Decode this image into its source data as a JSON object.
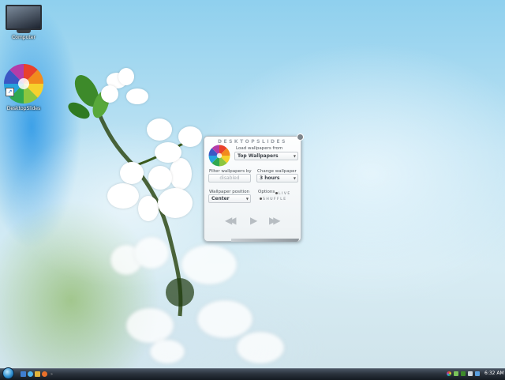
{
  "desktop": {
    "icons": [
      {
        "label": "Computer",
        "icon": "computer-icon"
      },
      {
        "label": "DesktopSlides",
        "icon": "desktopslides-icon"
      }
    ]
  },
  "gadget": {
    "title": "DESKTOPSLIDES",
    "load_label": "Load wallpapers from",
    "load_value": "Top Wallpapers",
    "filter_label": "Filter wallpapers by",
    "filter_value": "disabled",
    "change_label": "Change wallpaper in",
    "change_value": "3 hours",
    "position_label": "Wallpaper position",
    "position_value": "Center",
    "options_label": "Options",
    "options": [
      "LIVE",
      "SHUFFLE"
    ],
    "controls": {
      "prev": "◀◀",
      "play": "▶",
      "next": "▶▶"
    }
  },
  "taskbar": {
    "clock": "6:32 AM",
    "icons": [
      "start-orb-icon",
      "show-desktop-icon",
      "ie-icon",
      "explorer-icon",
      "media-icon"
    ]
  },
  "colors": {
    "gadget_bg": "#f7f9fa",
    "taskbar": "#1d242c",
    "sky": "#8fd0ee"
  }
}
